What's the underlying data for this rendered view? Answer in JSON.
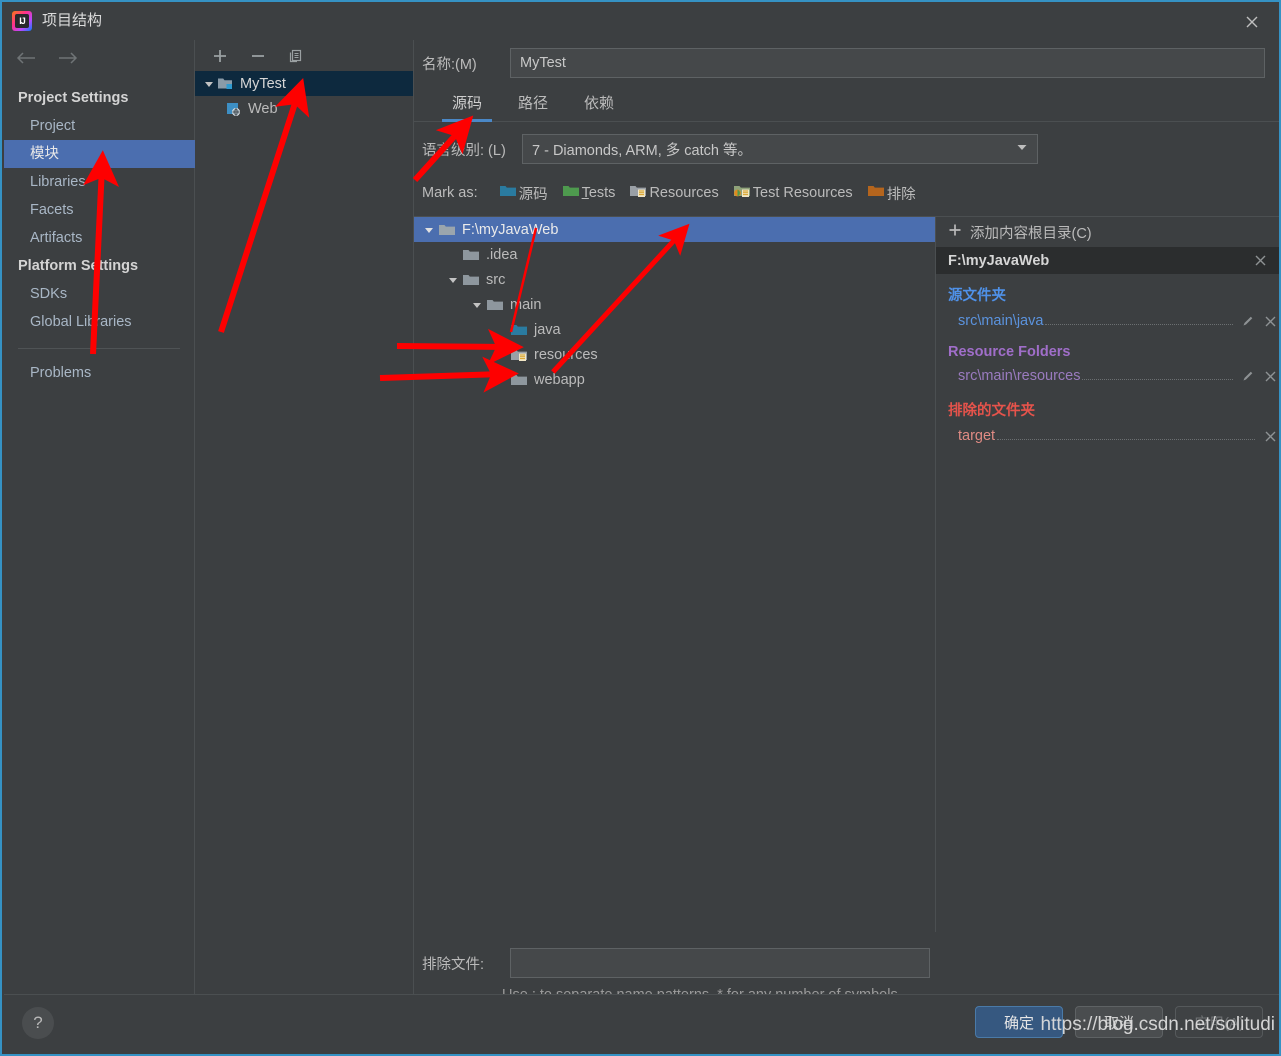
{
  "window": {
    "title": "项目结构",
    "app_icon": "intellij-idea-icon",
    "close_label": "×"
  },
  "sidebar": {
    "back_icon": "arrow-left-icon",
    "forward_icon": "arrow-right-icon",
    "groups": [
      {
        "label": "Project Settings",
        "items": [
          {
            "label": "Project",
            "selected": false
          },
          {
            "label": "模块",
            "selected": true
          },
          {
            "label": "Libraries",
            "selected": false
          },
          {
            "label": "Facets",
            "selected": false
          },
          {
            "label": "Artifacts",
            "selected": false
          }
        ]
      },
      {
        "label": "Platform Settings",
        "items": [
          {
            "label": "SDKs",
            "selected": false
          },
          {
            "label": "Global Libraries",
            "selected": false
          }
        ]
      }
    ],
    "footer_items": [
      {
        "label": "Problems",
        "selected": false
      }
    ],
    "selected_color": "#4b6eaf"
  },
  "module_panel": {
    "toolbar": {
      "add_label": "+",
      "remove_label": "−",
      "copy_label": "copy-icon"
    },
    "tree": [
      {
        "label": "MyTest",
        "icon": "module-folder-icon",
        "expanded": true,
        "selected": true,
        "depth": 0
      },
      {
        "label": "Web",
        "icon": "web-facet-icon",
        "expanded": false,
        "selected": false,
        "depth": 1
      }
    ]
  },
  "main": {
    "name_label": "名称:(M)",
    "name_value": "MyTest",
    "name_placeholder": "",
    "tabs": [
      {
        "label": "源码",
        "active": true
      },
      {
        "label": "路径",
        "active": false
      },
      {
        "label": "依赖",
        "active": false
      }
    ],
    "language_level": {
      "label": "语言级别: (L)",
      "value": "7 - Diamonds, ARM, 多 catch 等。",
      "chevron": "chevron-down-icon"
    },
    "mark_as": {
      "label": "Mark as:",
      "options": [
        {
          "label": "源码",
          "icon": "sources-folder-icon",
          "color": "#2a7ba0"
        },
        {
          "label": "Tests",
          "icon": "tests-folder-icon",
          "color": "#4e9a4e",
          "mnemonic": "T"
        },
        {
          "label": "Resources",
          "icon": "resources-folder-icon",
          "color": "#9aa0a6"
        },
        {
          "label": "Test Resources",
          "icon": "test-resources-folder-icon",
          "color": "#7fa35e"
        },
        {
          "label": "排除",
          "icon": "excluded-folder-icon",
          "color": "#b5651d"
        }
      ]
    },
    "content_tree": [
      {
        "label": "F:\\myJavaWeb",
        "depth": 0,
        "expanded": true,
        "selected": true,
        "icon": "folder-icon",
        "kind": "plain"
      },
      {
        "label": ".idea",
        "depth": 1,
        "expanded": null,
        "selected": false,
        "icon": "folder-icon",
        "kind": "plain"
      },
      {
        "label": "src",
        "depth": 1,
        "expanded": true,
        "selected": false,
        "icon": "folder-icon",
        "kind": "plain"
      },
      {
        "label": "main",
        "depth": 2,
        "expanded": true,
        "selected": false,
        "icon": "folder-icon",
        "kind": "plain"
      },
      {
        "label": "java",
        "depth": 3,
        "expanded": null,
        "selected": false,
        "icon": "sources-folder-icon",
        "kind": "sources"
      },
      {
        "label": "resources",
        "depth": 3,
        "expanded": null,
        "selected": false,
        "icon": "resources-folder-icon",
        "kind": "resources"
      },
      {
        "label": "webapp",
        "depth": 3,
        "expanded": false,
        "selected": false,
        "icon": "folder-icon",
        "kind": "plain"
      }
    ],
    "content_roots": {
      "add_label": "添加内容根目录(C)",
      "add_icon": "plus-icon",
      "root_path": "F:\\myJavaWeb",
      "root_remove_icon": "close-icon",
      "groups": [
        {
          "title": "源文件夹",
          "color": "#4f91e8",
          "entries": [
            {
              "path": "src\\main\\java",
              "color": "#5b93de",
              "edit_icon": "pencil-icon",
              "remove_icon": "close-icon",
              "has_edit": true
            }
          ]
        },
        {
          "title": "Resource Folders",
          "color": "#a06ec9",
          "entries": [
            {
              "path": "src\\main\\resources",
              "color": "#9a7bbf",
              "edit_icon": "pencil-icon",
              "remove_icon": "close-icon",
              "has_edit": true
            }
          ]
        },
        {
          "title": "排除的文件夹",
          "color": "#e5534b",
          "entries": [
            {
              "path": "target",
              "color": "#e08b84",
              "edit_icon": "",
              "remove_icon": "close-icon",
              "has_edit": false
            }
          ]
        }
      ]
    },
    "exclude_files": {
      "label": "排除文件:",
      "value": "",
      "placeholder": "",
      "hint": "Use ; to separate name patterns, * for any number of symbols, ? for one."
    }
  },
  "bottom": {
    "help_label": "?",
    "buttons": [
      {
        "label": "确定",
        "style": "primary",
        "enabled": true
      },
      {
        "label": "取消",
        "style": "normal",
        "enabled": true
      },
      {
        "label": "应用(A)",
        "style": "disabled",
        "enabled": false
      }
    ]
  },
  "watermark": {
    "text": "https://blog.csdn.net/solitudi"
  },
  "annotations": {
    "color": "#fe0000",
    "arrows": [
      "arrow-to-modules-sidebar-item",
      "arrow-to-mytest-module",
      "arrow-to-sources-tab",
      "arrow-to-java-folder",
      "arrow-to-resources-folder",
      "arrow-to-resources-mark-button"
    ]
  }
}
